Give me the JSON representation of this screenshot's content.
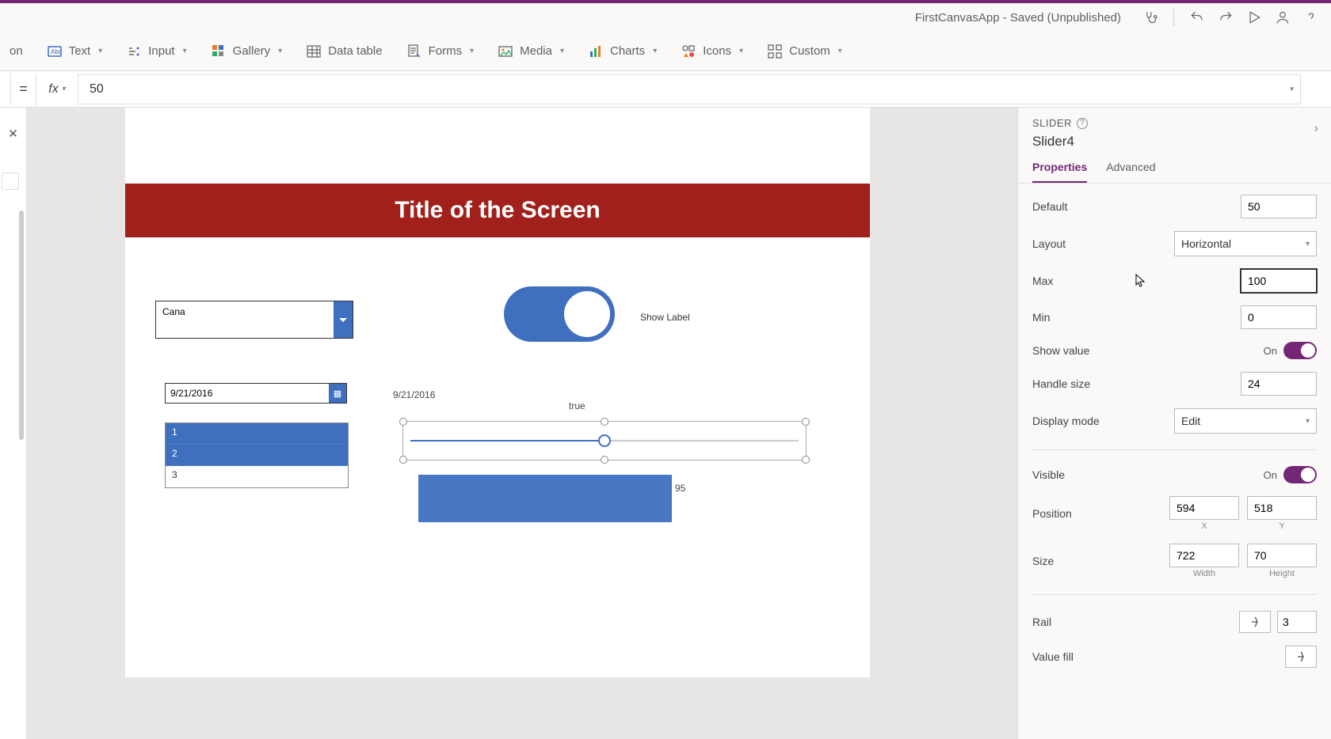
{
  "appTitle": "FirstCanvasApp - Saved (Unpublished)",
  "ribbon": {
    "text": "Text",
    "input": "Input",
    "gallery": "Gallery",
    "datatable": "Data table",
    "forms": "Forms",
    "media": "Media",
    "charts": "Charts",
    "icons": "Icons",
    "custom": "Custom",
    "partial": "on"
  },
  "formula": {
    "value": "50"
  },
  "canvas": {
    "title": "Title of the Screen",
    "dropdownValue": "Cana",
    "showLabel": "Show Label",
    "dateValue": "9/21/2016",
    "dateLabel": "9/21/2016",
    "trueLabel": "true",
    "list": [
      "1",
      "2",
      "3"
    ],
    "num95": "95"
  },
  "props": {
    "type": "SLIDER",
    "name": "Slider4",
    "tabs": {
      "properties": "Properties",
      "advanced": "Advanced"
    },
    "labels": {
      "default": "Default",
      "layout": "Layout",
      "max": "Max",
      "min": "Min",
      "showValue": "Show value",
      "handleSize": "Handle size",
      "displayMode": "Display mode",
      "visible": "Visible",
      "position": "Position",
      "size": "Size",
      "rail": "Rail",
      "valueFill": "Value fill",
      "x": "X",
      "y": "Y",
      "width": "Width",
      "height": "Height",
      "on": "On"
    },
    "values": {
      "default": "50",
      "layout": "Horizontal",
      "max": "100",
      "min": "0",
      "handleSize": "24",
      "displayMode": "Edit",
      "posX": "594",
      "posY": "518",
      "sizeW": "722",
      "sizeH": "70",
      "railBorder": "3"
    }
  }
}
